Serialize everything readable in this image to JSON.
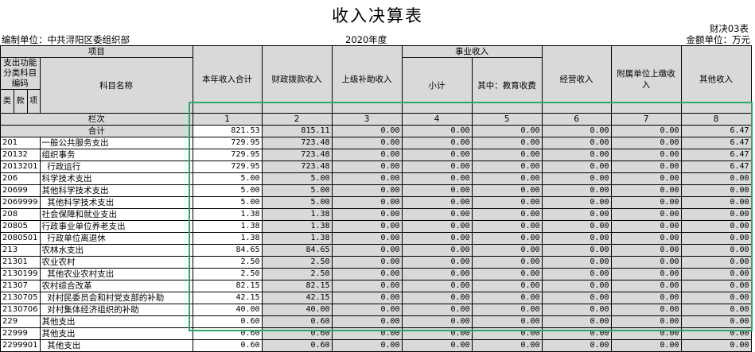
{
  "title": "收入决算表",
  "form_no": "财决03表",
  "unit": "编制单位：中共浔阳区委组织部",
  "year": "2020年度",
  "currency": "金额单位：万元",
  "headers": {
    "item": "项目",
    "func_class": "支出功能分类科目编码",
    "lei": "类",
    "kuan": "款",
    "xiang": "项",
    "subject_name": "科目名称",
    "col_total": "本年收入合计",
    "col_fiscal": "财政拨款收入",
    "col_upper": "上级补助收入",
    "col_business": "事业收入",
    "col_subtotal": "小计",
    "col_edu": "其中：教育收费",
    "col_operating": "经营收入",
    "col_affiliated": "附属单位上缴收入",
    "col_other": "其他收入",
    "row_label": "栏次",
    "col_nums": [
      "1",
      "2",
      "3",
      "4",
      "5",
      "6",
      "7",
      "8"
    ],
    "total_label": "合计"
  },
  "total_row": [
    "821.53",
    "815.11",
    "0.00",
    "0.00",
    "0.00",
    "0.00",
    "0.00",
    "6.47"
  ],
  "rows": [
    {
      "code": "201",
      "name": "一般公共服务支出",
      "v": [
        "729.95",
        "723.48",
        "0.00",
        "0.00",
        "0.00",
        "0.00",
        "0.00",
        "6.47"
      ]
    },
    {
      "code": "20132",
      "name": "组织事务",
      "v": [
        "729.95",
        "723.48",
        "0.00",
        "0.00",
        "0.00",
        "0.00",
        "0.00",
        "6.47"
      ]
    },
    {
      "code": "2013201",
      "name": "  行政运行",
      "v": [
        "729.95",
        "723.48",
        "0.00",
        "0.00",
        "0.00",
        "0.00",
        "0.00",
        "6.47"
      ]
    },
    {
      "code": "206",
      "name": "科学技术支出",
      "v": [
        "5.00",
        "5.00",
        "0.00",
        "0.00",
        "0.00",
        "0.00",
        "0.00",
        "0.00"
      ]
    },
    {
      "code": "20699",
      "name": "其他科学技术支出",
      "v": [
        "5.00",
        "5.00",
        "0.00",
        "0.00",
        "0.00",
        "0.00",
        "0.00",
        "0.00"
      ]
    },
    {
      "code": "2069999",
      "name": "  其他科学技术支出",
      "v": [
        "5.00",
        "5.00",
        "0.00",
        "0.00",
        "0.00",
        "0.00",
        "0.00",
        "0.00"
      ]
    },
    {
      "code": "208",
      "name": "社会保障和就业支出",
      "v": [
        "1.38",
        "1.38",
        "0.00",
        "0.00",
        "0.00",
        "0.00",
        "0.00",
        "0.00"
      ]
    },
    {
      "code": "20805",
      "name": "行政事业单位养老支出",
      "v": [
        "1.38",
        "1.38",
        "0.00",
        "0.00",
        "0.00",
        "0.00",
        "0.00",
        "0.00"
      ]
    },
    {
      "code": "2080501",
      "name": "  行政单位离退休",
      "v": [
        "1.38",
        "1.38",
        "0.00",
        "0.00",
        "0.00",
        "0.00",
        "0.00",
        "0.00"
      ]
    },
    {
      "code": "213",
      "name": "农林水支出",
      "v": [
        "84.65",
        "84.65",
        "0.00",
        "0.00",
        "0.00",
        "0.00",
        "0.00",
        "0.00"
      ]
    },
    {
      "code": "21301",
      "name": "农业农村",
      "v": [
        "2.50",
        "2.50",
        "0.00",
        "0.00",
        "0.00",
        "0.00",
        "0.00",
        "0.00"
      ]
    },
    {
      "code": "2130199",
      "name": "  其他农业农村支出",
      "v": [
        "2.50",
        "2.50",
        "0.00",
        "0.00",
        "0.00",
        "0.00",
        "0.00",
        "0.00"
      ]
    },
    {
      "code": "21307",
      "name": "农村综合改革",
      "v": [
        "82.15",
        "82.15",
        "0.00",
        "0.00",
        "0.00",
        "0.00",
        "0.00",
        "0.00"
      ]
    },
    {
      "code": "2130705",
      "name": "  对村民委员会和村党支部的补助",
      "v": [
        "42.15",
        "42.15",
        "0.00",
        "0.00",
        "0.00",
        "0.00",
        "0.00",
        "0.00"
      ]
    },
    {
      "code": "2130706",
      "name": "  对村集体经济组织的补助",
      "v": [
        "40.00",
        "40.00",
        "0.00",
        "0.00",
        "0.00",
        "0.00",
        "0.00",
        "0.00"
      ]
    },
    {
      "code": "229",
      "name": "其他支出",
      "v": [
        "0.60",
        "0.60",
        "0.00",
        "0.00",
        "0.00",
        "0.00",
        "0.00",
        "0.00"
      ]
    },
    {
      "code": "22999",
      "name": "其他支出",
      "v": [
        "0.60",
        "0.60",
        "0.00",
        "0.00",
        "0.00",
        "0.00",
        "0.00",
        "0.00"
      ]
    },
    {
      "code": "2299901",
      "name": "  其他支出",
      "v": [
        "0.60",
        "0.60",
        "0.00",
        "0.00",
        "0.00",
        "0.00",
        "0.00",
        "0.00"
      ]
    }
  ]
}
